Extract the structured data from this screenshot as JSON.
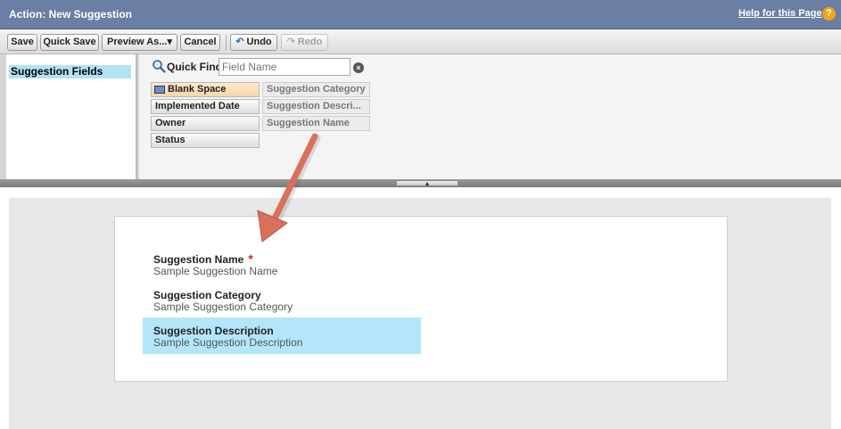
{
  "header": {
    "title": "Action: New Suggestion",
    "help_link": "Help for this Page",
    "help_icon_glyph": "?"
  },
  "toolbar": {
    "save": "Save",
    "quick_save": "Quick Save",
    "preview_as": "Preview As...",
    "preview_dropdown_glyph": "▾",
    "cancel": "Cancel",
    "undo": "Undo",
    "undo_glyph": "↶",
    "redo": "Redo",
    "redo_glyph": "↷"
  },
  "palette": {
    "categories": [
      {
        "label": "Suggestion Fields",
        "selected": true
      }
    ],
    "quick_find": {
      "label": "Quick Find",
      "placeholder": "Field Name",
      "clear_glyph": "×"
    },
    "fields": [
      {
        "label": "Blank Space",
        "state": "blank"
      },
      {
        "label": "Implemented Date",
        "state": "available"
      },
      {
        "label": "Owner",
        "state": "available"
      },
      {
        "label": "Status",
        "state": "available"
      },
      {
        "label": "Suggestion Category",
        "state": "used"
      },
      {
        "label": "Suggestion Descri...",
        "state": "used"
      },
      {
        "label": "Suggestion Name",
        "state": "used"
      }
    ]
  },
  "splitter": {
    "glyph": "▴"
  },
  "layout": {
    "fields": [
      {
        "name": "Suggestion Name",
        "sample": "Sample Suggestion Name",
        "required": true,
        "required_glyph": "*",
        "selected": false
      },
      {
        "name": "Suggestion Category",
        "sample": "Sample Suggestion Category",
        "required": false,
        "selected": false
      },
      {
        "name": "Suggestion Description",
        "sample": "Sample Suggestion Description",
        "required": false,
        "selected": true
      }
    ]
  },
  "colors": {
    "header_bg": "#6a7fa3",
    "selection_blue": "#b3e6fb",
    "required_red": "#d8281c",
    "help_orange": "#f2a31b",
    "annotation_arrow": "#d9705c"
  },
  "icons": [
    "magnifier-icon",
    "clear-search-icon",
    "help-icon",
    "undo-icon",
    "redo-icon",
    "blank-space-icon",
    "annotation-arrow"
  ]
}
